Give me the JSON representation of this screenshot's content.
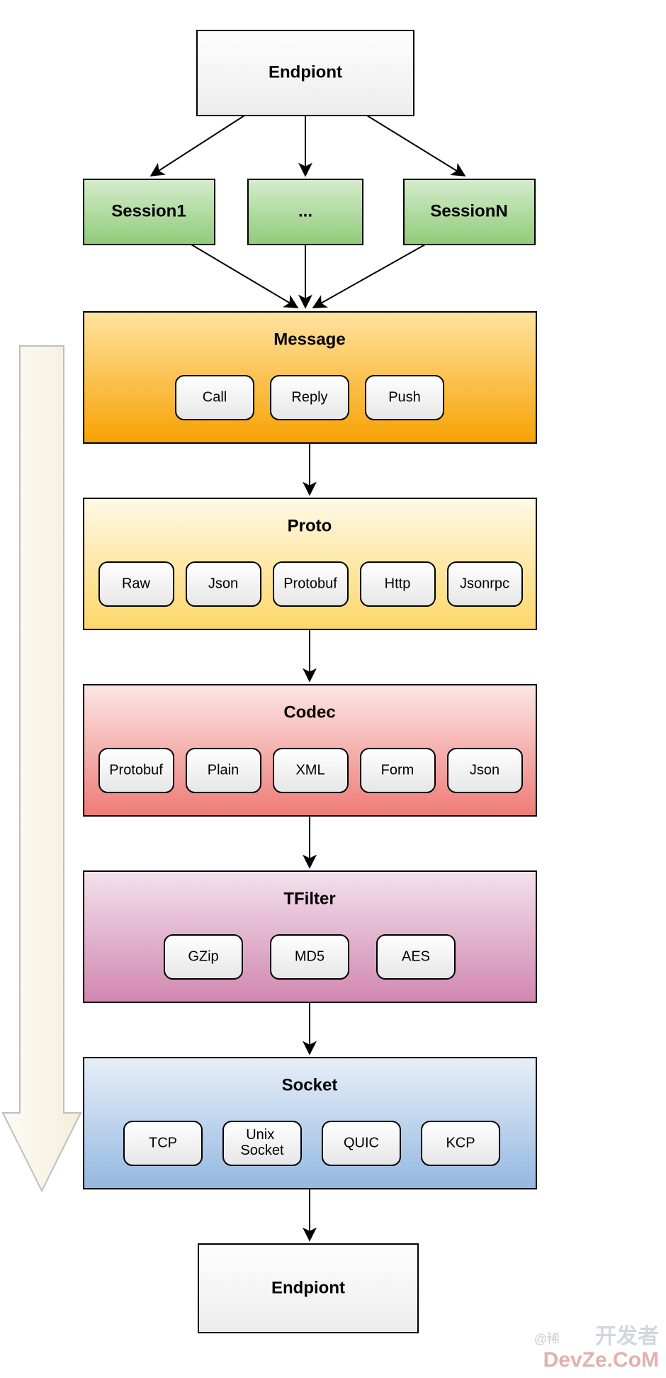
{
  "endpoint_top": "Endpiont",
  "sessions": {
    "a": "Session1",
    "b": "...",
    "c": "SessionN"
  },
  "message": {
    "title": "Message",
    "items": [
      "Call",
      "Reply",
      "Push"
    ]
  },
  "proto": {
    "title": "Proto",
    "items": [
      "Raw",
      "Json",
      "Protobuf",
      "Http",
      "Jsonrpc"
    ]
  },
  "codec": {
    "title": "Codec",
    "items": [
      "Protobuf",
      "Plain",
      "XML",
      "Form",
      "Json"
    ]
  },
  "tfilter": {
    "title": "TFilter",
    "items": [
      "GZip",
      "MD5",
      "AES"
    ]
  },
  "socket": {
    "title": "Socket",
    "items": [
      "TCP",
      "Unix\nSocket",
      "QUIC",
      "KCP"
    ]
  },
  "endpoint_bottom": "Endpiont",
  "watermark_small": "@稀",
  "watermark_top": "开发者",
  "watermark_bottom": "DevZe.CoM"
}
